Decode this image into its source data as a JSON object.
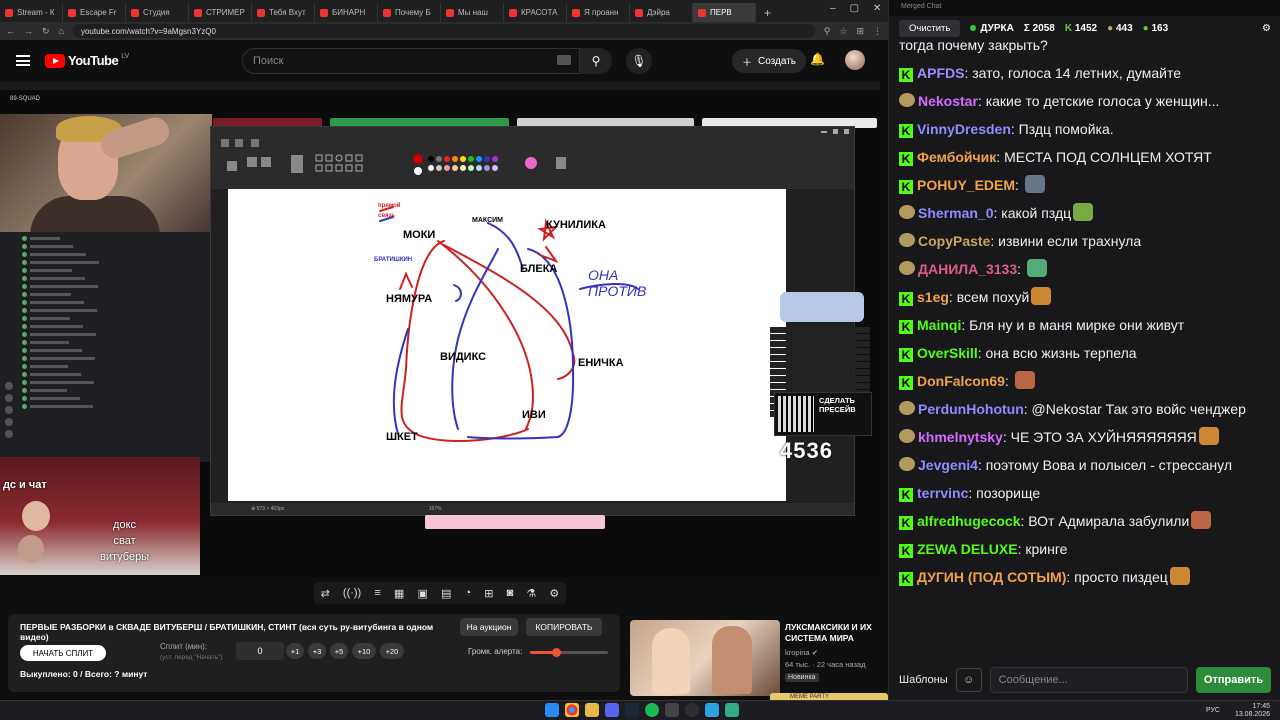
{
  "browser": {
    "tabs": [
      "Stream - К",
      "Escape Fr",
      "Студия",
      "СТРИМЕР",
      "Тебя Вхут",
      "БИНАРН",
      "Почему Б",
      "Мы наш",
      "КРАСОТА",
      "Я проанн",
      "Дэйра",
      "ПЕРВ"
    ],
    "new_tab": "+",
    "url": "youtube.com/watch?v=9aMgsn3YzQ0"
  },
  "youtube": {
    "logo": "YouTube",
    "region": "LV",
    "search_placeholder": "Поиск",
    "create_label": "Создать"
  },
  "video": {
    "squad": "89-SQUAD",
    "overlay_label": "дс и чат",
    "overlay_lines": [
      "докс",
      "сват",
      "витуберы"
    ],
    "qr_text": "СДЕЛАТЬ ПРЕСЕЙВ",
    "donation_count": "4536",
    "drawing_labels": [
      "прямой",
      "связь",
      "МАКСИМ",
      "КУНИЛИКА",
      "МОКИ",
      "БРАТИШКИН",
      "БЛЕКА",
      "ОНА ПРОТИВ",
      "НЯМУРА",
      "ВИДИКС",
      "ЕНИЧКА",
      "ИВИ",
      "ШКЕТ"
    ]
  },
  "extension": {
    "title": "ПЕРВЫЕ РАЗБОРКИ в СКВАДЕ ВИТУБЕРШ / БРАТИШКИН, СТИНТ (вся суть ру-витубинга в одном видео)",
    "auction_label": "На аукцион",
    "copy_label": "КОПИРОВАТЬ",
    "start_label": "НАЧАТЬ СПЛИТ",
    "split_label": "Сплит (мин):",
    "split_hint": "(уст. перед \"Начать\")",
    "split_value": "0",
    "split_buttons": [
      "+1",
      "+3",
      "+5",
      "+10",
      "+20"
    ],
    "volume_label": "Громк. алерта:",
    "volume_level": 0.33,
    "bought_text": "Выкуплено: 0 / Всего: ? минут"
  },
  "recommendation": {
    "title": "ЛУКСМАКСИКИ И ИХ СИСТЕМА МИРА",
    "channel": "kropina",
    "meta": "64 тыс. · 22 часа назад",
    "badge": "Новинка",
    "meme_bar": "MEME PARTY"
  },
  "chat": {
    "window_title": "Merged Chat",
    "clear_label": "Очистить",
    "streamer": "ДУРКА",
    "total": "Σ 2058",
    "kick_count": "1452",
    "count_b": "443",
    "count_c": "163",
    "first_line": "тогда почему  закрыть?",
    "messages": [
      {
        "badge": "k",
        "user": "APFDS",
        "color": "#9f8cff",
        "text": "зато, голоса 14 летних, думайте"
      },
      {
        "badge": "s",
        "user": "Nekostar",
        "color": "#d56bff",
        "text": "какие то детские голоса у женщин..."
      },
      {
        "badge": "k",
        "user": "VinnyDresden",
        "color": "#8f8cff",
        "text": "Пздц помойка."
      },
      {
        "badge": "k",
        "user": "Фембойчик",
        "color": "#f0a24b",
        "text": "МЕСТА ПОД СОЛНЦЕМ ХОТЯТ"
      },
      {
        "badge": "k",
        "user": "POHUY_EDEM",
        "color": "#f0a24b",
        "text": ""
      },
      {
        "badge": "s",
        "user": "Sherman_0",
        "color": "#8f8cff",
        "text": "какой пздц"
      },
      {
        "badge": "s",
        "user": "CopyPaste",
        "color": "#c8a55a",
        "text": "извини если трахнула"
      },
      {
        "badge": "s",
        "user": "ДАНИЛА_3133",
        "color": "#e05a8a",
        "text": ""
      },
      {
        "badge": "k",
        "user": "s1eg",
        "color": "#f0a24b",
        "text": "всем похуй"
      },
      {
        "badge": "k",
        "user": "Mainqi",
        "color": "#53fc18",
        "text": "Бля ну и в маня мирке они живут"
      },
      {
        "badge": "k",
        "user": "OverSkill",
        "color": "#53fc18",
        "text": "она всю жизнь терпела"
      },
      {
        "badge": "k",
        "user": "DonFalcon69",
        "color": "#f0a24b",
        "text": ""
      },
      {
        "badge": "s",
        "user": "PerdunHohotun",
        "color": "#8f8cff",
        "text": "@Nekostar Так это войс ченджер"
      },
      {
        "badge": "s",
        "user": "khmelnytsky",
        "color": "#d56bff",
        "text": "ЧЕ ЭТО ЗА ХУЙНЯЯЯЯЯЯЯ"
      },
      {
        "badge": "s",
        "user": "Jevgeni4",
        "color": "#8f8cff",
        "text": "поэтому Вова и полысел - стрессанул"
      },
      {
        "badge": "k",
        "user": "terrvinc",
        "color": "#8f8cff",
        "text": "позорище"
      },
      {
        "badge": "k",
        "user": "alfredhugecock",
        "color": "#53fc18",
        "text": "ВОт Адмирала забулили"
      },
      {
        "badge": "k",
        "user": "ZEWA DELUXE",
        "color": "#53fc18",
        "text": "кринге"
      },
      {
        "badge": "k",
        "user": "ДУГИН (ПОД СОТЫМ)",
        "color": "#f0a24b",
        "text": "просто пиздец"
      }
    ],
    "templates_label": "Шаблоны",
    "input_placeholder": "Сообщение...",
    "send_label": "Отправить"
  },
  "taskbar": {
    "lang": "РУС",
    "time": "17:45",
    "date": "13.08.2026"
  }
}
